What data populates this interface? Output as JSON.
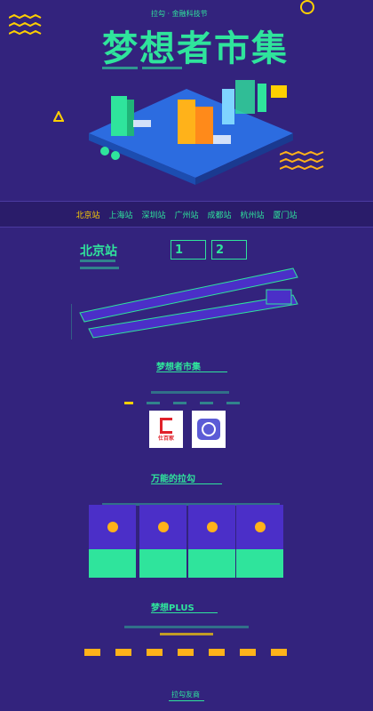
{
  "hero": {
    "subtitle": "拉勾 · 金融科技节",
    "title": "梦想者市集"
  },
  "tabs": [
    {
      "label": "北京站",
      "active": true
    },
    {
      "label": "上海站",
      "active": false
    },
    {
      "label": "深圳站",
      "active": false
    },
    {
      "label": "广州站",
      "active": false
    },
    {
      "label": "成都站",
      "active": false
    },
    {
      "label": "杭州站",
      "active": false
    },
    {
      "label": "厦门站",
      "active": false
    }
  ],
  "station": {
    "name": "北京站",
    "steps": [
      "1",
      "2"
    ]
  },
  "market": {
    "heading": "梦想者市集",
    "logos": [
      {
        "label": "仕百家"
      },
      {
        "label": ""
      }
    ]
  },
  "lagou": {
    "heading": "万能的拉勾",
    "cards": [
      {
        "icon": "star-icon",
        "label": ""
      },
      {
        "icon": "spark-icon",
        "label": ""
      },
      {
        "icon": "grid-icon",
        "label": ""
      },
      {
        "icon": "chevron-icon",
        "label": ""
      }
    ]
  },
  "plus": {
    "heading": "梦想PLUS",
    "tags": [
      "",
      "",
      "",
      "",
      "",
      "",
      ""
    ]
  },
  "footer": {
    "heading": "拉勾友商"
  },
  "colors": {
    "background": "#33237d",
    "accent": "#2fe49c",
    "card": "#4b2fc8",
    "tag": "#ffb21a",
    "active_tab": "#ffd000"
  }
}
